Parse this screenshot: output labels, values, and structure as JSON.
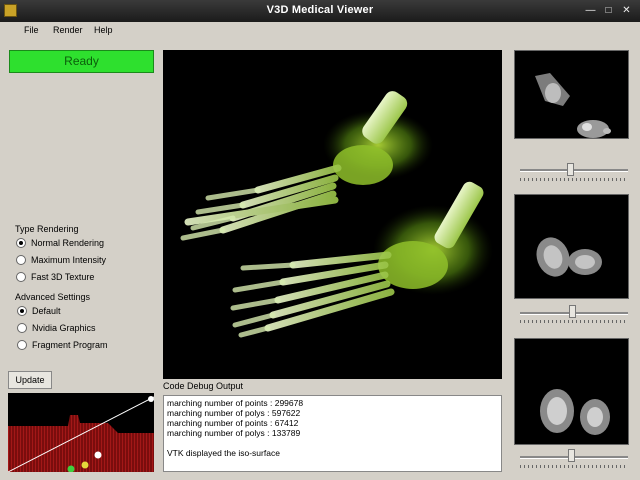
{
  "window": {
    "title": "V3D Medical Viewer"
  },
  "menu": {
    "file": "File",
    "render": "Render",
    "help": "Help"
  },
  "status": {
    "text": "Ready",
    "color": "#2ee02e"
  },
  "type_rendering": {
    "label": "Type Rendering",
    "options": [
      {
        "label": "Normal Rendering",
        "selected": true
      },
      {
        "label": "Maximum Intensity",
        "selected": false
      },
      {
        "label": "Fast 3D Texture",
        "selected": false
      }
    ]
  },
  "advanced_settings": {
    "label": "Advanced Settings",
    "options": [
      {
        "label": "Default",
        "selected": true
      },
      {
        "label": "Nvidia Graphics",
        "selected": false
      },
      {
        "label": "Fragment Program",
        "selected": false
      }
    ]
  },
  "update_button": {
    "label": "Update"
  },
  "debug": {
    "label": "Code Debug Output",
    "lines": [
      "marching number of points : 299678",
      "marching number of polys : 597622",
      "marching number of points : 67412",
      "marching number of polys : 133789",
      "",
      "VTK displayed the iso-surface"
    ]
  },
  "slice_sliders": [
    {
      "name": "axial",
      "value": 0.47
    },
    {
      "name": "coronal",
      "value": 0.49
    },
    {
      "name": "sagittal",
      "value": 0.48
    }
  ],
  "icons": [
    "app-icon",
    "minimize-icon",
    "maximize-icon",
    "close-icon"
  ]
}
